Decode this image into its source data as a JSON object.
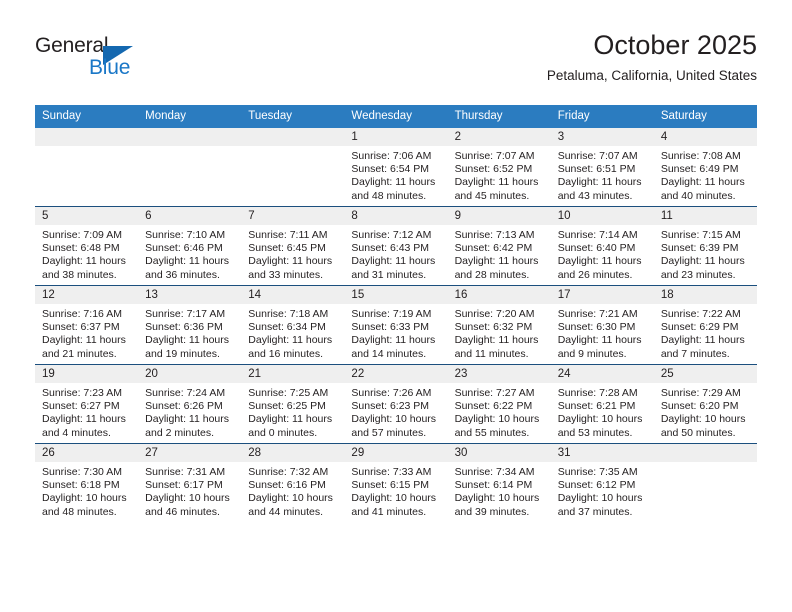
{
  "brand": {
    "name_part1": "General",
    "name_part2": "Blue",
    "accent_color": "#1a77c7"
  },
  "header": {
    "title": "October 2025",
    "subtitle": "Petaluma, California, United States",
    "header_bg_color": "#2b7cc0"
  },
  "weekdays": [
    "Sunday",
    "Monday",
    "Tuesday",
    "Wednesday",
    "Thursday",
    "Friday",
    "Saturday"
  ],
  "labels": {
    "sunrise_prefix": "Sunrise:",
    "sunset_prefix": "Sunset:",
    "daylight_prefix": "Daylight:"
  },
  "weeks": [
    [
      {
        "day": "",
        "empty": true
      },
      {
        "day": "",
        "empty": true
      },
      {
        "day": "",
        "empty": true
      },
      {
        "day": "1",
        "sunrise": "Sunrise: 7:06 AM",
        "sunset": "Sunset: 6:54 PM",
        "daylight": "Daylight: 11 hours and 48 minutes."
      },
      {
        "day": "2",
        "sunrise": "Sunrise: 7:07 AM",
        "sunset": "Sunset: 6:52 PM",
        "daylight": "Daylight: 11 hours and 45 minutes."
      },
      {
        "day": "3",
        "sunrise": "Sunrise: 7:07 AM",
        "sunset": "Sunset: 6:51 PM",
        "daylight": "Daylight: 11 hours and 43 minutes."
      },
      {
        "day": "4",
        "sunrise": "Sunrise: 7:08 AM",
        "sunset": "Sunset: 6:49 PM",
        "daylight": "Daylight: 11 hours and 40 minutes."
      }
    ],
    [
      {
        "day": "5",
        "sunrise": "Sunrise: 7:09 AM",
        "sunset": "Sunset: 6:48 PM",
        "daylight": "Daylight: 11 hours and 38 minutes."
      },
      {
        "day": "6",
        "sunrise": "Sunrise: 7:10 AM",
        "sunset": "Sunset: 6:46 PM",
        "daylight": "Daylight: 11 hours and 36 minutes."
      },
      {
        "day": "7",
        "sunrise": "Sunrise: 7:11 AM",
        "sunset": "Sunset: 6:45 PM",
        "daylight": "Daylight: 11 hours and 33 minutes."
      },
      {
        "day": "8",
        "sunrise": "Sunrise: 7:12 AM",
        "sunset": "Sunset: 6:43 PM",
        "daylight": "Daylight: 11 hours and 31 minutes."
      },
      {
        "day": "9",
        "sunrise": "Sunrise: 7:13 AM",
        "sunset": "Sunset: 6:42 PM",
        "daylight": "Daylight: 11 hours and 28 minutes."
      },
      {
        "day": "10",
        "sunrise": "Sunrise: 7:14 AM",
        "sunset": "Sunset: 6:40 PM",
        "daylight": "Daylight: 11 hours and 26 minutes."
      },
      {
        "day": "11",
        "sunrise": "Sunrise: 7:15 AM",
        "sunset": "Sunset: 6:39 PM",
        "daylight": "Daylight: 11 hours and 23 minutes."
      }
    ],
    [
      {
        "day": "12",
        "sunrise": "Sunrise: 7:16 AM",
        "sunset": "Sunset: 6:37 PM",
        "daylight": "Daylight: 11 hours and 21 minutes."
      },
      {
        "day": "13",
        "sunrise": "Sunrise: 7:17 AM",
        "sunset": "Sunset: 6:36 PM",
        "daylight": "Daylight: 11 hours and 19 minutes."
      },
      {
        "day": "14",
        "sunrise": "Sunrise: 7:18 AM",
        "sunset": "Sunset: 6:34 PM",
        "daylight": "Daylight: 11 hours and 16 minutes."
      },
      {
        "day": "15",
        "sunrise": "Sunrise: 7:19 AM",
        "sunset": "Sunset: 6:33 PM",
        "daylight": "Daylight: 11 hours and 14 minutes."
      },
      {
        "day": "16",
        "sunrise": "Sunrise: 7:20 AM",
        "sunset": "Sunset: 6:32 PM",
        "daylight": "Daylight: 11 hours and 11 minutes."
      },
      {
        "day": "17",
        "sunrise": "Sunrise: 7:21 AM",
        "sunset": "Sunset: 6:30 PM",
        "daylight": "Daylight: 11 hours and 9 minutes."
      },
      {
        "day": "18",
        "sunrise": "Sunrise: 7:22 AM",
        "sunset": "Sunset: 6:29 PM",
        "daylight": "Daylight: 11 hours and 7 minutes."
      }
    ],
    [
      {
        "day": "19",
        "sunrise": "Sunrise: 7:23 AM",
        "sunset": "Sunset: 6:27 PM",
        "daylight": "Daylight: 11 hours and 4 minutes."
      },
      {
        "day": "20",
        "sunrise": "Sunrise: 7:24 AM",
        "sunset": "Sunset: 6:26 PM",
        "daylight": "Daylight: 11 hours and 2 minutes."
      },
      {
        "day": "21",
        "sunrise": "Sunrise: 7:25 AM",
        "sunset": "Sunset: 6:25 PM",
        "daylight": "Daylight: 11 hours and 0 minutes."
      },
      {
        "day": "22",
        "sunrise": "Sunrise: 7:26 AM",
        "sunset": "Sunset: 6:23 PM",
        "daylight": "Daylight: 10 hours and 57 minutes."
      },
      {
        "day": "23",
        "sunrise": "Sunrise: 7:27 AM",
        "sunset": "Sunset: 6:22 PM",
        "daylight": "Daylight: 10 hours and 55 minutes."
      },
      {
        "day": "24",
        "sunrise": "Sunrise: 7:28 AM",
        "sunset": "Sunset: 6:21 PM",
        "daylight": "Daylight: 10 hours and 53 minutes."
      },
      {
        "day": "25",
        "sunrise": "Sunrise: 7:29 AM",
        "sunset": "Sunset: 6:20 PM",
        "daylight": "Daylight: 10 hours and 50 minutes."
      }
    ],
    [
      {
        "day": "26",
        "sunrise": "Sunrise: 7:30 AM",
        "sunset": "Sunset: 6:18 PM",
        "daylight": "Daylight: 10 hours and 48 minutes."
      },
      {
        "day": "27",
        "sunrise": "Sunrise: 7:31 AM",
        "sunset": "Sunset: 6:17 PM",
        "daylight": "Daylight: 10 hours and 46 minutes."
      },
      {
        "day": "28",
        "sunrise": "Sunrise: 7:32 AM",
        "sunset": "Sunset: 6:16 PM",
        "daylight": "Daylight: 10 hours and 44 minutes."
      },
      {
        "day": "29",
        "sunrise": "Sunrise: 7:33 AM",
        "sunset": "Sunset: 6:15 PM",
        "daylight": "Daylight: 10 hours and 41 minutes."
      },
      {
        "day": "30",
        "sunrise": "Sunrise: 7:34 AM",
        "sunset": "Sunset: 6:14 PM",
        "daylight": "Daylight: 10 hours and 39 minutes."
      },
      {
        "day": "31",
        "sunrise": "Sunrise: 7:35 AM",
        "sunset": "Sunset: 6:12 PM",
        "daylight": "Daylight: 10 hours and 37 minutes."
      },
      {
        "day": "",
        "empty": true
      }
    ]
  ]
}
